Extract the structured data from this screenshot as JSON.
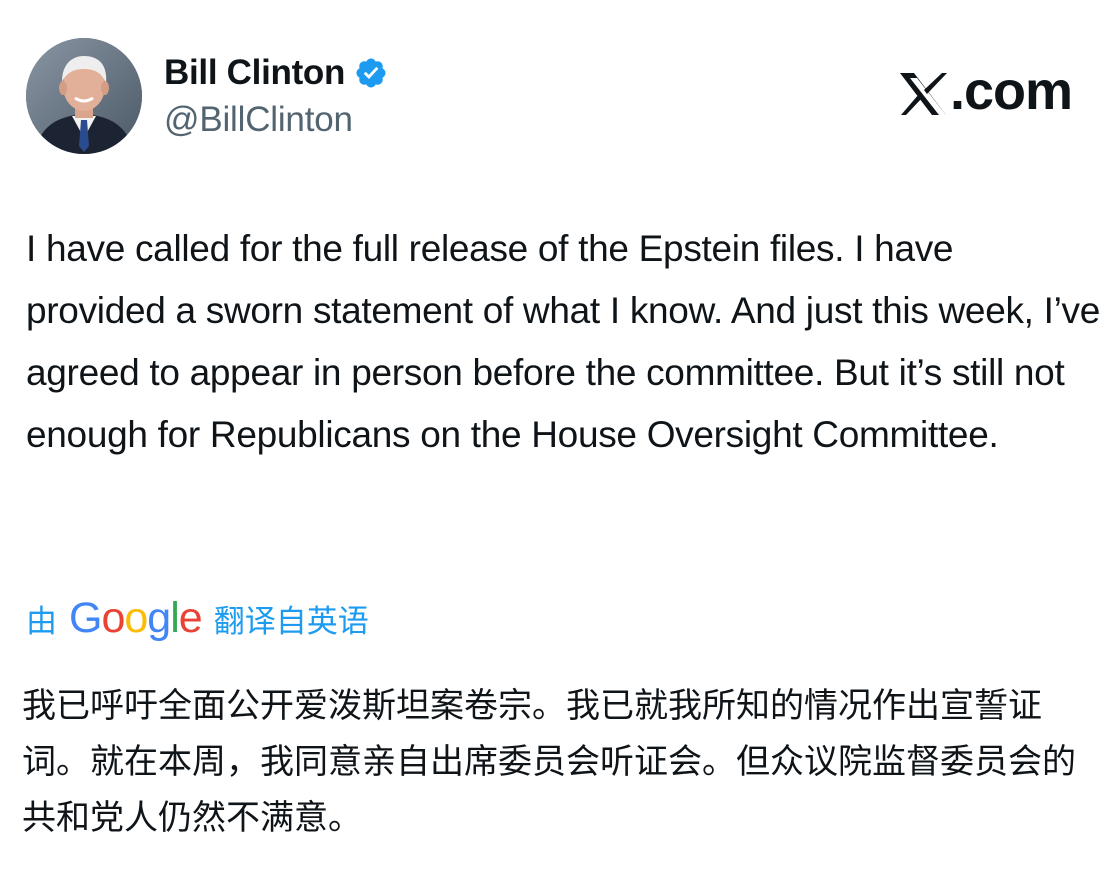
{
  "author": {
    "display_name": "Bill Clinton",
    "handle": "@BillClinton",
    "verified_icon": "verified-badge-icon",
    "avatar_icon": "profile-photo"
  },
  "brand": {
    "label": ".com",
    "logo_icon": "x-logo-icon"
  },
  "tweet": {
    "text": "I have called for the full release of the Epstein files. I have provided a sworn statement of what I know. And just this week, I’ve agreed to appear in person before the committee. But it’s still not enough for Republicans on the House Oversight Committee."
  },
  "translation": {
    "prefix": "由",
    "google_letters": [
      "G",
      "o",
      "o",
      "g",
      "l",
      "e"
    ],
    "suffix": "翻译自英语",
    "text": "我已呼吁全面公开爱泼斯坦案卷宗。我已就我所知的情况作出宣誓证词。就在本周，我同意亲自出席委员会听证会。但众议院监督委员会的共和党人仍然不满意。"
  },
  "colors": {
    "verified": "#1d9bf0",
    "link": "#1d9bf0",
    "text": "#0f1419",
    "secondary": "#536471"
  }
}
